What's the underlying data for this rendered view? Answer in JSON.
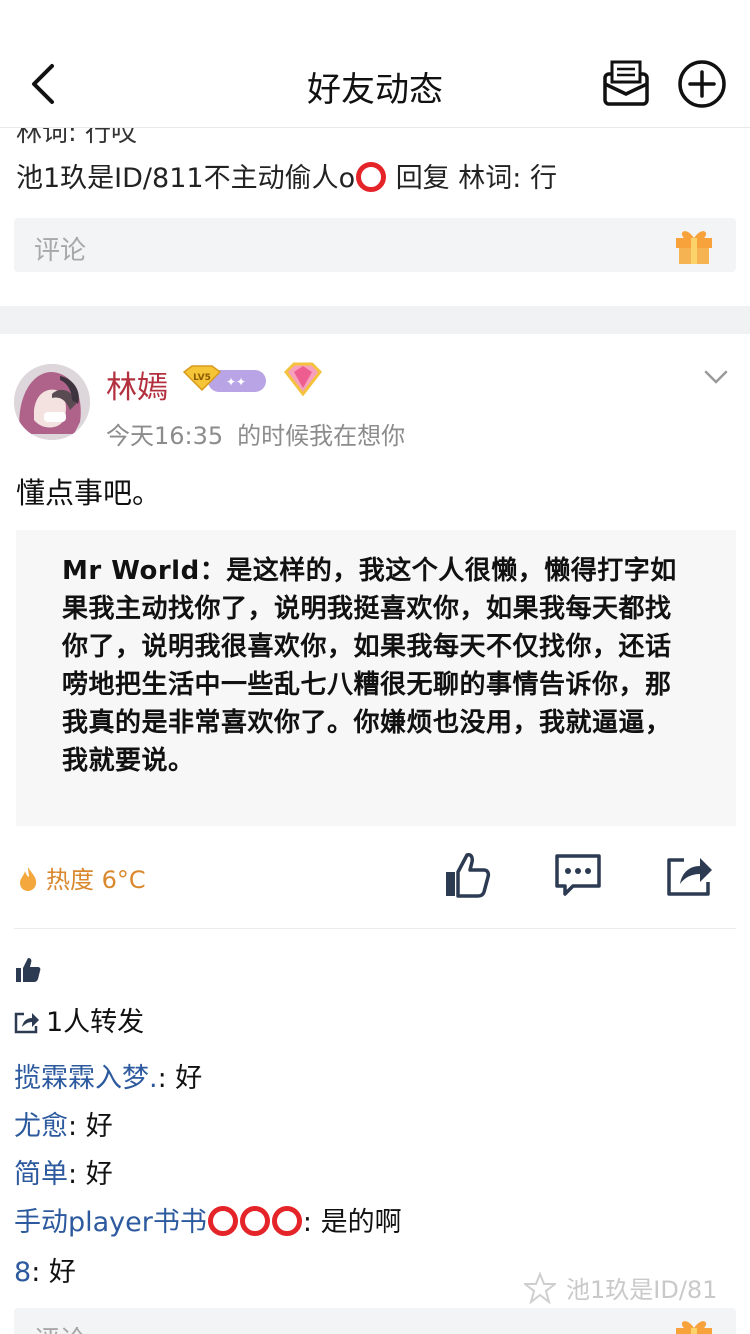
{
  "header": {
    "title": "好友动态"
  },
  "previous_post": {
    "cut_line": "林词: 行哎",
    "reply": {
      "from": "池1玖是ID/811不主动偷人o",
      "action": "回复",
      "to": "林词",
      "text": "行"
    },
    "comment_placeholder": "评论"
  },
  "post": {
    "username": "林嫣",
    "badge_level": "LV5",
    "timestamp": "今天16:35",
    "signature": "的时候我在想你",
    "text": "懂点事吧。",
    "quote_image_text": "Mr World：是这样的，我这个人很懒，懒得打字如果我主动找你了，说明我挺喜欢你，如果我每天都找你了，说明我很喜欢你，如果我每天不仅找你，还话唠地把生活中一些乱七八糟很无聊的事情告诉你，那我真的是非常喜欢你了。你嫌烦也没用，我就逼逼，我就要说。",
    "heat_label": "热度 6°C",
    "share_count_label": "1人转发",
    "replies": [
      {
        "name": "揽霖霖入梦.",
        "text": "好"
      },
      {
        "name": "尤愈",
        "text": "好"
      },
      {
        "name": "简单",
        "text": "好"
      },
      {
        "name": "手动player书书",
        "text": "是的啊"
      },
      {
        "name": "8",
        "text": "好"
      }
    ],
    "comment_placeholder": "评论"
  },
  "watermark": "池1玖是ID/81",
  "colors": {
    "username": "#b3313f",
    "reply_name": "#2d5a9e",
    "heat": "#d9882e",
    "ring": "#e5242a",
    "icon": "#2c3a52"
  }
}
